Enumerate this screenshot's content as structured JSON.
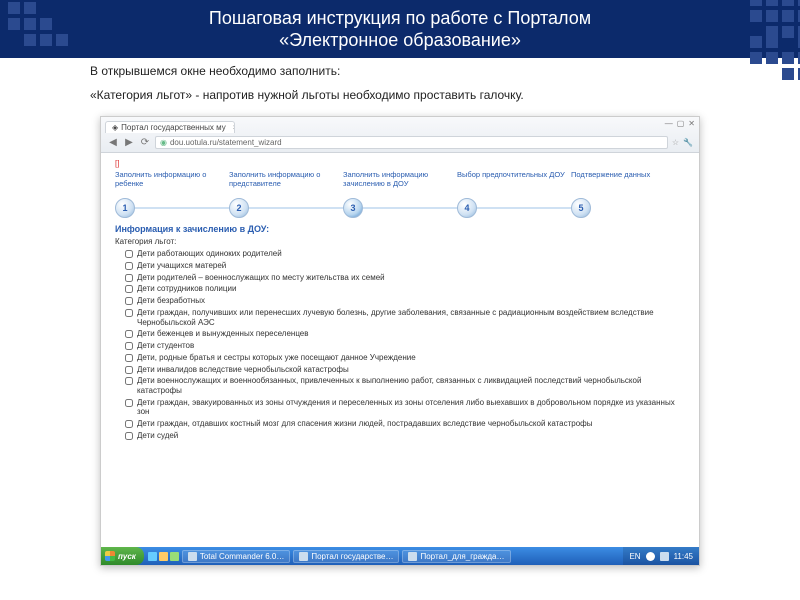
{
  "banner": {
    "title_l1": "Пошаговая инструкция по работе с Порталом",
    "title_l2": "«Электронное образование»"
  },
  "instruction": {
    "line1": "В открывшемся окне необходимо заполнить:",
    "line2": "«Категория льгот» - напротив нужной льготы необходимо проставить галочку."
  },
  "browser": {
    "tab_title": "Портал государственных му",
    "url": "dou.uotula.ru/statement_wizard",
    "win_min": "—",
    "win_max": "▢",
    "win_close": "✕"
  },
  "wizard": {
    "steps": [
      {
        "n": "1",
        "label": "Заполнить информацию о ребенке"
      },
      {
        "n": "2",
        "label": "Заполнить информацию о представителе"
      },
      {
        "n": "3",
        "label": "Заполнить информацию зачислению в ДОУ"
      },
      {
        "n": "4",
        "label": "Выбор предпочтительных ДОУ"
      },
      {
        "n": "5",
        "label": "Подтвержение данных"
      }
    ],
    "active_step": 3,
    "section_title": "Информация к зачислению в ДОУ:",
    "field_label": "Категория льгот:",
    "options": [
      "Дети работающих одиноких родителей",
      "Дети учащихся матерей",
      "Дети родителей – военнослужащих по месту жительства их семей",
      "Дети сотрудников полиции",
      "Дети безработных",
      "Дети граждан, получивших или перенесших лучевую болезнь, другие заболевания, связанные с радиационным воздействием вследствие Чернобыльской АЭС",
      "Дети беженцев и вынужденных переселенцев",
      "Дети студентов",
      "Дети, родные братья и сестры которых уже посещают данное Учреждение",
      "Дети инвалидов вследствие чернобыльской катастрофы",
      "Дети военнослужащих и военнообязанных, привлеченных к выполнению работ, связанных с ликвидацией последствий чернобыльской катастрофы",
      "Дети граждан, эвакуированных из зоны отчуждения и переселенных из зоны отселения либо выехавших в добровольном порядке из указанных зон",
      "Дети граждан, отдавших костный мозг для спасения жизни людей, пострадавших вследствие чернобыльской катастрофы",
      "Дети судей"
    ]
  },
  "taskbar": {
    "start": "пуск",
    "items": [
      "Total Commander 6.0…",
      "Портал государстве…",
      "Портал_для_гражда…"
    ],
    "lang": "EN",
    "time": "11:45"
  }
}
